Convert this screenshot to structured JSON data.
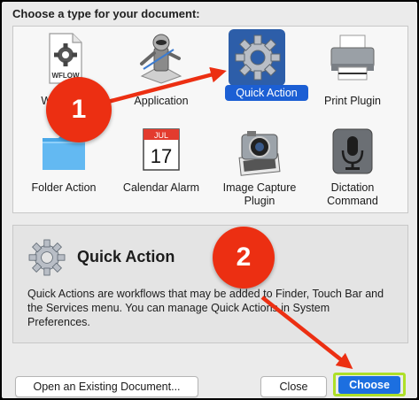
{
  "dialog": {
    "heading": "Choose a type for your document:"
  },
  "types": [
    {
      "label": "Workflow",
      "icon": "workflow-document-icon",
      "icon_text": "WFLOW"
    },
    {
      "label": "Application",
      "icon": "automator-robot-icon"
    },
    {
      "label": "Quick Action",
      "icon": "gear-icon",
      "selected": true
    },
    {
      "label": "Print Plugin",
      "icon": "printer-icon"
    },
    {
      "label": "Folder Action",
      "icon": "folder-icon"
    },
    {
      "label": "Calendar Alarm",
      "icon": "calendar-icon",
      "icon_month": "JUL",
      "icon_day": "17"
    },
    {
      "label": "Image Capture Plugin",
      "line1": "Image Capture",
      "line2": "Plugin",
      "icon": "camera-icon"
    },
    {
      "label": "Dictation Command",
      "line1": "Dictation",
      "line2": "Command",
      "icon": "microphone-icon"
    }
  ],
  "description": {
    "title": "Quick Action",
    "text": "Quick Actions are workflows that may be added to Finder, Touch Bar and the Services menu. You can manage Quick Actions in System Preferences.",
    "icon": "gear-icon"
  },
  "buttons": {
    "open_existing": "Open an Existing Document...",
    "close": "Close",
    "choose": "Choose"
  },
  "annotations": {
    "badge1": "1",
    "badge2": "2",
    "badge_color": "#ec2f12",
    "highlight_color": "#aee028"
  },
  "colors": {
    "selection": "#1c5fd4",
    "default_button": "#1c6fe0"
  }
}
